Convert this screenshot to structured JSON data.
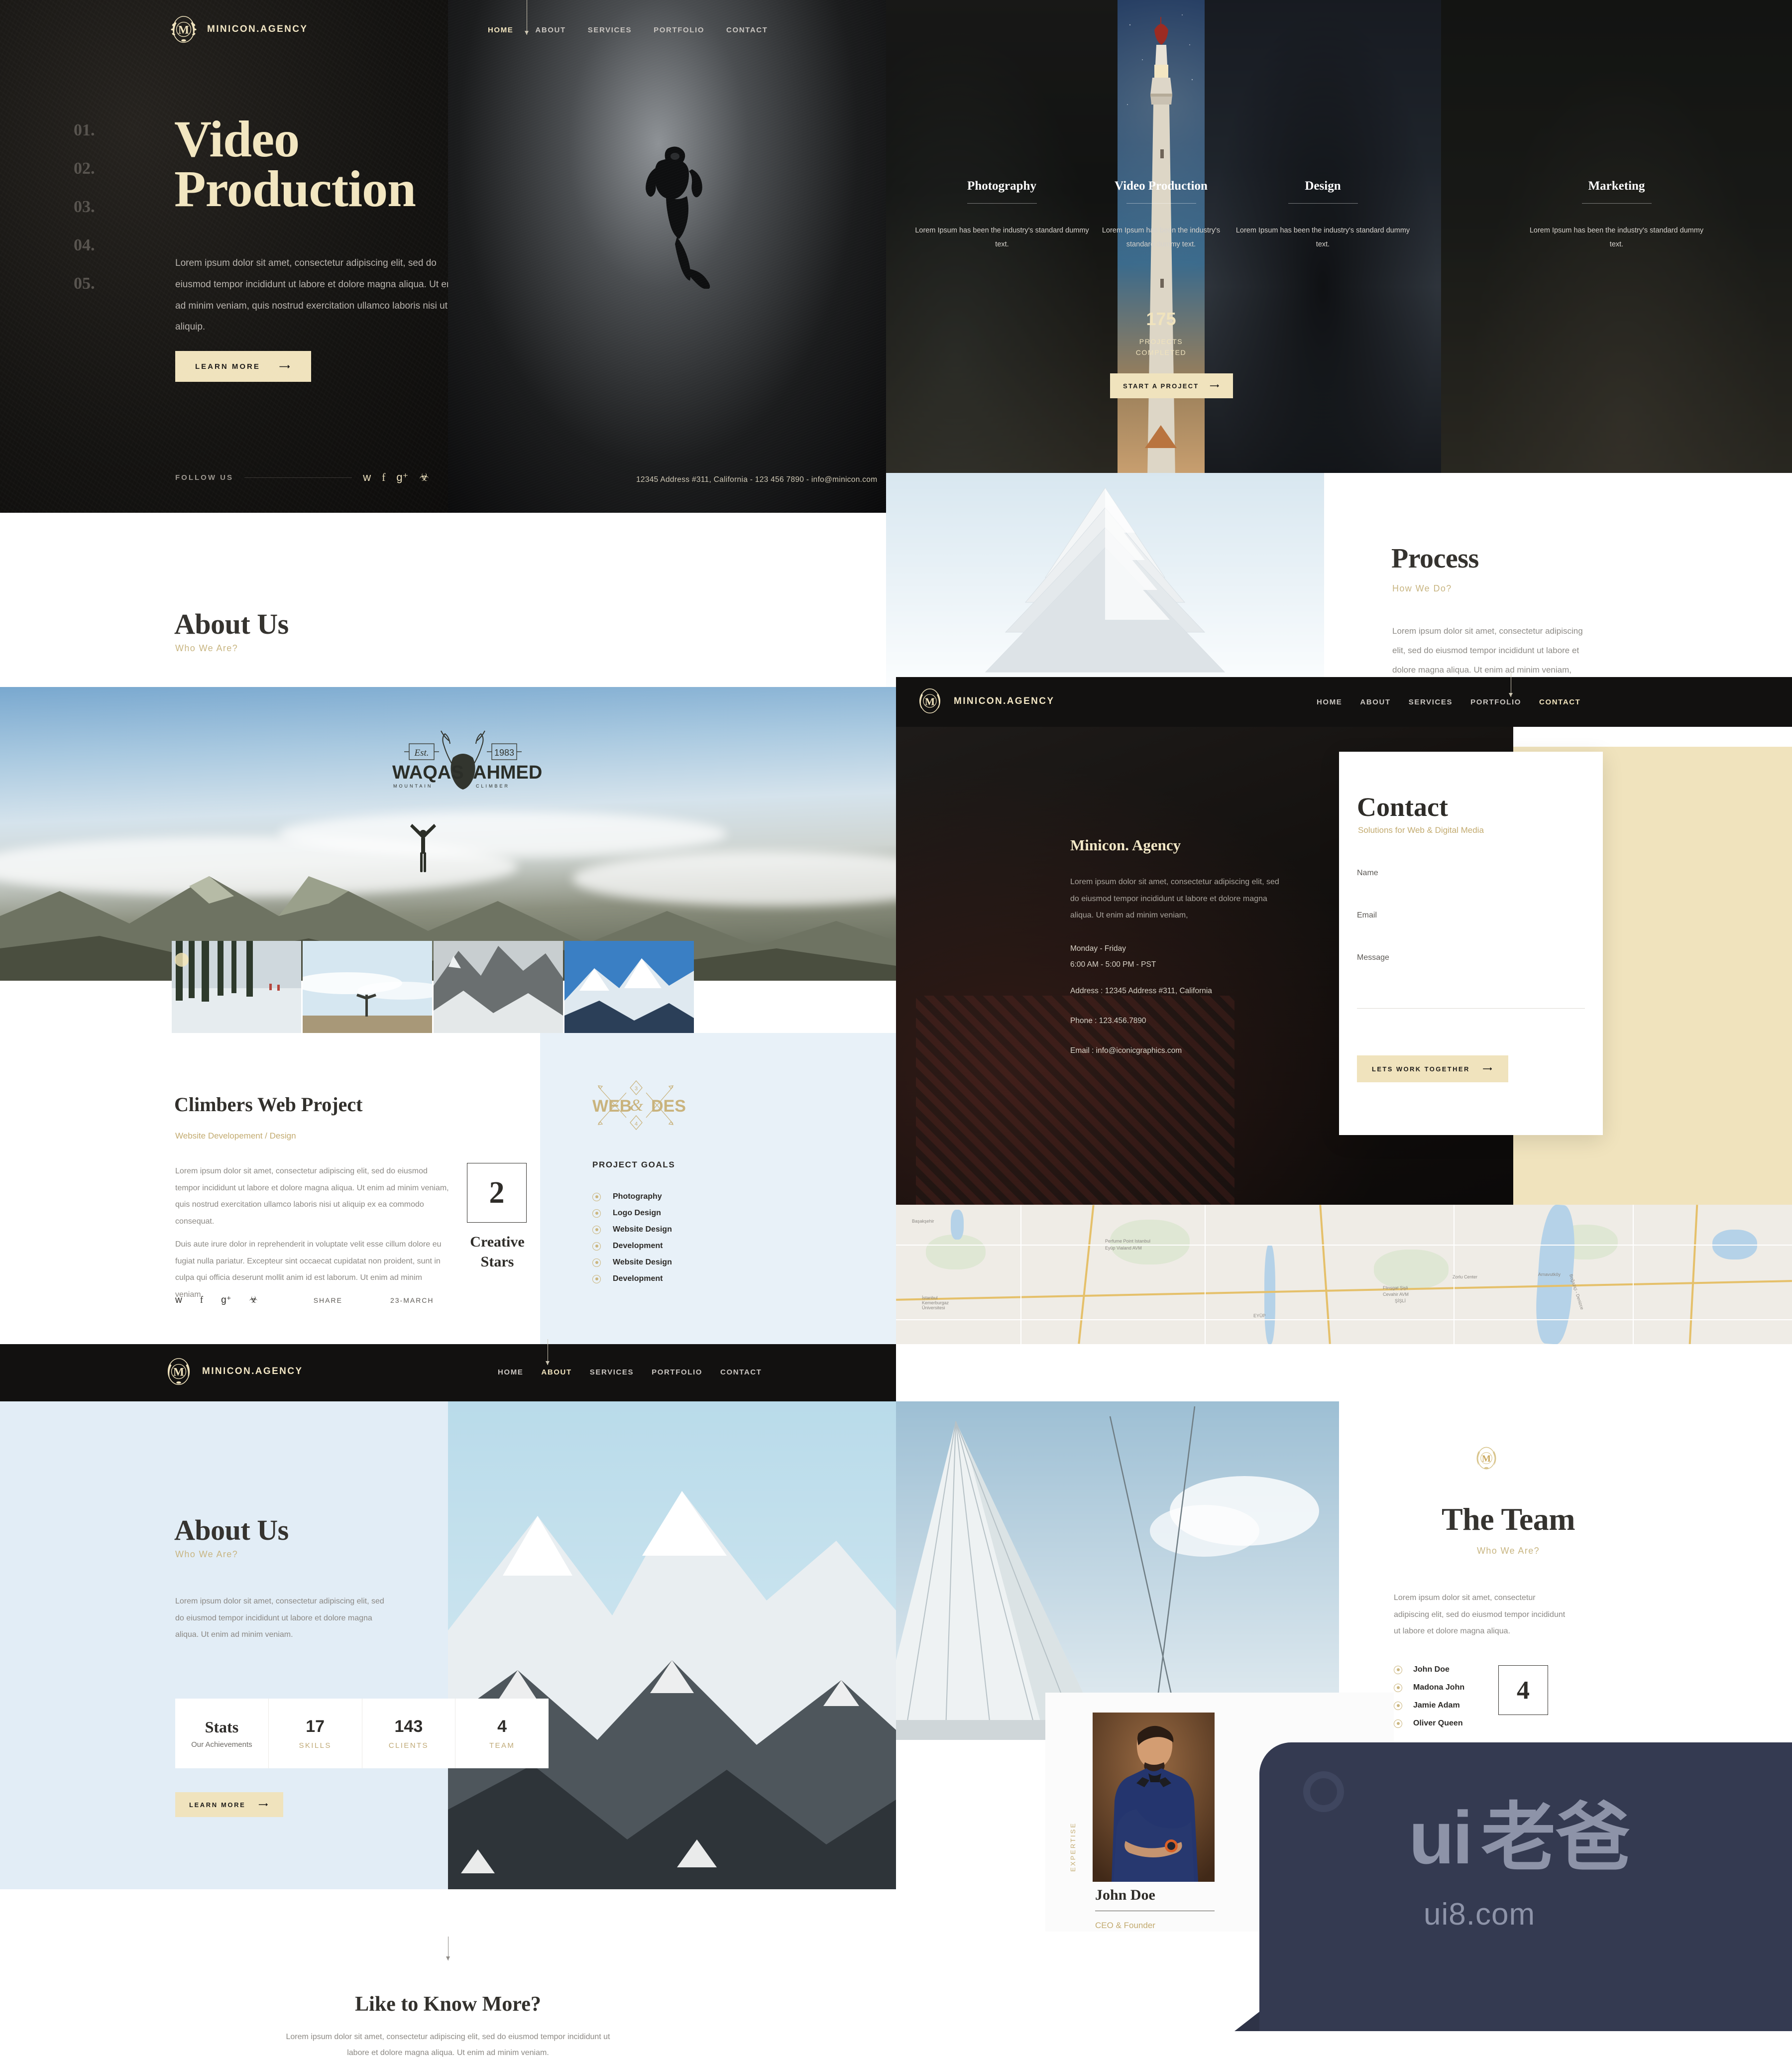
{
  "brand": {
    "name": "MINICON.AGENCY",
    "monogram": "M"
  },
  "nav": {
    "items": [
      "HOME",
      "ABOUT",
      "SERVICES",
      "PORTFOLIO",
      "CONTACT"
    ],
    "active_hero": "HOME",
    "active_about": "ABOUT",
    "active_contact": "CONTACT"
  },
  "hero": {
    "steps": [
      "01.",
      "02.",
      "03.",
      "04.",
      "05."
    ],
    "active_step": "02.",
    "title_line1": "Video",
    "title_line2": "Production",
    "body": "Lorem ipsum dolor sit amet, consectetur adipiscing elit, sed do eiusmod tempor incididunt ut labore et dolore magna aliqua. Ut enim ad minim veniam, quis nostrud exercitation ullamco laboris nisi ut aliquip.",
    "cta": "LEARN MORE",
    "follow_label": "FOLLOW US",
    "contact_strip": "12345 Address #311, California  -   123 456 7890  -   info@minicon.com",
    "social": [
      "twitter-icon",
      "facebook-icon",
      "google-plus-icon",
      "rss-icon"
    ]
  },
  "services": [
    {
      "title": "Photography",
      "desc": "Lorem Ipsum has been the industry's standard dummy text."
    },
    {
      "title": "Video Production",
      "desc": "Lorem Ipsum has been the industry's standard dummy text.",
      "count": "175",
      "count_label_1": "PROJECTS",
      "count_label_2": "COMPLETED",
      "cta": "START A PROJECT"
    },
    {
      "title": "Design",
      "desc": "Lorem Ipsum has been the industry's standard dummy text."
    },
    {
      "title": "Marketing",
      "desc": "Lorem Ipsum has been the industry's standard dummy text."
    }
  ],
  "about_1": {
    "title": "About Us",
    "subtitle": "Who We Are?"
  },
  "process": {
    "title": "Process",
    "subtitle": "How We Do?",
    "body": "Lorem ipsum dolor sit amet, consectetur adipiscing elit, sed do eiusmod tempor incididunt ut labore et dolore magna aliqua. Ut enim ad minim veniam, quis nostrud"
  },
  "climber_logo": {
    "name_1": "WAQAS",
    "name_2": "AHMED",
    "sub_1": "MOUNTAIN",
    "sub_2": "CLIMBER",
    "est": "Est.",
    "year": "1983"
  },
  "project": {
    "title": "Climbers Web Project",
    "category": "Website Developement / Design",
    "paragraph_1": "Lorem ipsum dolor sit amet, consectetur adipiscing elit, sed do eiusmod tempor incididunt ut labore et dolore magna aliqua. Ut enim ad minim veniam, quis nostrud exercitation ullamco laboris nisi ut aliquip ex ea commodo consequat.",
    "paragraph_2": "Duis aute irure dolor in reprehenderit in voluptate velit esse cillum dolore eu fugiat nulla pariatur. Excepteur sint occaecat cupidatat non proident, sunt in culpa qui officia deserunt mollit anim id est laborum. Ut enim ad minim veniam.",
    "stat_number": "2",
    "stat_label_1": "Creative",
    "stat_label_2": "Stars",
    "share_label": "SHARE",
    "date": "23-MARCH",
    "social": [
      "twitter-icon",
      "facebook-icon",
      "google-plus-icon",
      "rss-icon"
    ],
    "side_logo": {
      "left": "WEB",
      "amp": "&",
      "right": "DES",
      "num_top": "3",
      "num_bottom": "4"
    },
    "goals_heading": "PROJECT GOALS",
    "goals": [
      "Photography",
      "Logo Design",
      "Website Design",
      "Development",
      "Website Design",
      "Development"
    ]
  },
  "contact": {
    "brand": "Minicon. Agency",
    "body": "Lorem ipsum dolor sit amet, consectetur adipiscing elit, sed do eiusmod tempor incididunt ut labore et dolore magna aliqua. Ut enim ad minim veniam,",
    "hours_days": "Monday  -  Friday",
    "hours_time": "6:00 AM  -  5:00 PM  -  PST",
    "address": "Address : 12345 Address #311, California",
    "phone": "Phone : 123.456.7890",
    "email": "Email : info@iconicgraphics.com",
    "form_title": "Contact",
    "form_subtitle": "Solutions for Web & Digital Media",
    "fields": [
      {
        "label": "Name",
        "value": ""
      },
      {
        "label": "Email",
        "value": ""
      },
      {
        "label": "Message",
        "value": ""
      }
    ],
    "cta": "LETS WORK TOGETHER"
  },
  "map": {
    "labels": [
      "Başakşehir",
      "Perfume Point Istanbul",
      "Eyüp Vialand AVM",
      "Zorlu Center",
      "Flinşgat Şişli",
      "Cevahir AVM",
      "ŞİŞLİ",
      "EYÜP",
      "Arnavutköy",
      "İstanbul Kemerburgaz Üniversitesi",
      "Boğaziçi - Denizce"
    ]
  },
  "about_2": {
    "title": "About Us",
    "subtitle": "Who We Are?",
    "body": "Lorem ipsum dolor sit amet, consectetur adipiscing elit, sed do eiusmod tempor incididunt ut labore et dolore magna aliqua. Ut enim ad minim veniam.",
    "stats_word": "Stats",
    "stats_sub": "Our Achievements",
    "stats": [
      {
        "value": "17",
        "label": "SKILLS"
      },
      {
        "value": "143",
        "label": "CLIENTS"
      },
      {
        "value": "4",
        "label": "TEAM"
      }
    ],
    "cta": "LEARN MORE"
  },
  "team": {
    "title": "The Team",
    "subtitle": "Who We Are?",
    "body": "Lorem ipsum dolor sit amet, consectetur adipiscing elit, sed do eiusmod tempor incididunt ut labore et dolore magna aliqua.",
    "members": [
      "John Doe",
      "Madona John",
      "Jamie Adam",
      "Oliver Queen"
    ],
    "count": "4",
    "profile": {
      "expertise_label": "EXPERTISE",
      "name": "John Doe",
      "role": "CEO & Founder"
    }
  },
  "footer": {
    "title": "Like to Know More?",
    "body_line1": "Lorem ipsum dolor sit amet, consectetur adipiscing elit, sed do eiusmod tempor incididunt ut",
    "body_line2": "labore et dolore magna aliqua. Ut enim ad minim veniam."
  },
  "watermark": {
    "ui": "ui",
    "cn": "老爸",
    "url": "ui8.com"
  },
  "colors": {
    "cream": "#f0e3bd",
    "gold": "#c3ab70",
    "dark": "#121110",
    "ice_blue": "#e2edf6"
  }
}
